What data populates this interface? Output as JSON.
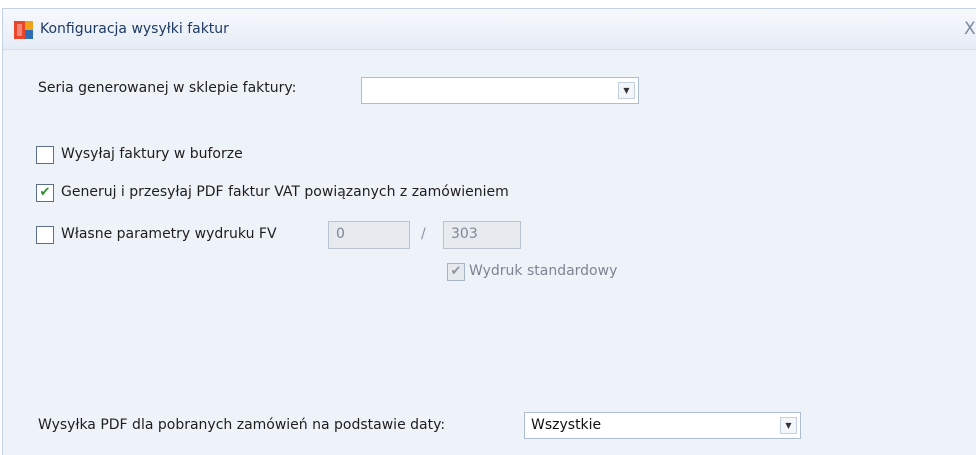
{
  "window": {
    "title": "Konfiguracja wysyłki faktur",
    "close_glyph": "X"
  },
  "series": {
    "label": "Seria generowanej w sklepie faktury:",
    "value": ""
  },
  "options": {
    "send_buffered": {
      "label": "Wysyłaj faktury w buforze",
      "checked": false
    },
    "generate_pdf": {
      "label": "Generuj i przesyłaj PDF faktur VAT powiązanych z zamówieniem",
      "checked": true
    },
    "custom_print": {
      "label": "Własne parametry wydruku FV",
      "checked": false,
      "value_a": "0",
      "separator": "/",
      "value_b": "303"
    },
    "standard_print": {
      "label": "Wydruk standardowy",
      "checked": true,
      "enabled": false
    }
  },
  "pdf_dispatch": {
    "label": "Wysyłka PDF dla pobranych zamówień na podstawie daty:",
    "value": "Wszystkie"
  },
  "colors": {
    "panel": "#eef2f9",
    "check_mark": "#2f8e2f",
    "icon_red": "#e8452c",
    "icon_blue": "#2d6db5"
  },
  "icons": {
    "app": "app-logo-icon",
    "close": "close-icon",
    "dropdown": "chevron-down-icon",
    "check": "checkmark-icon"
  }
}
